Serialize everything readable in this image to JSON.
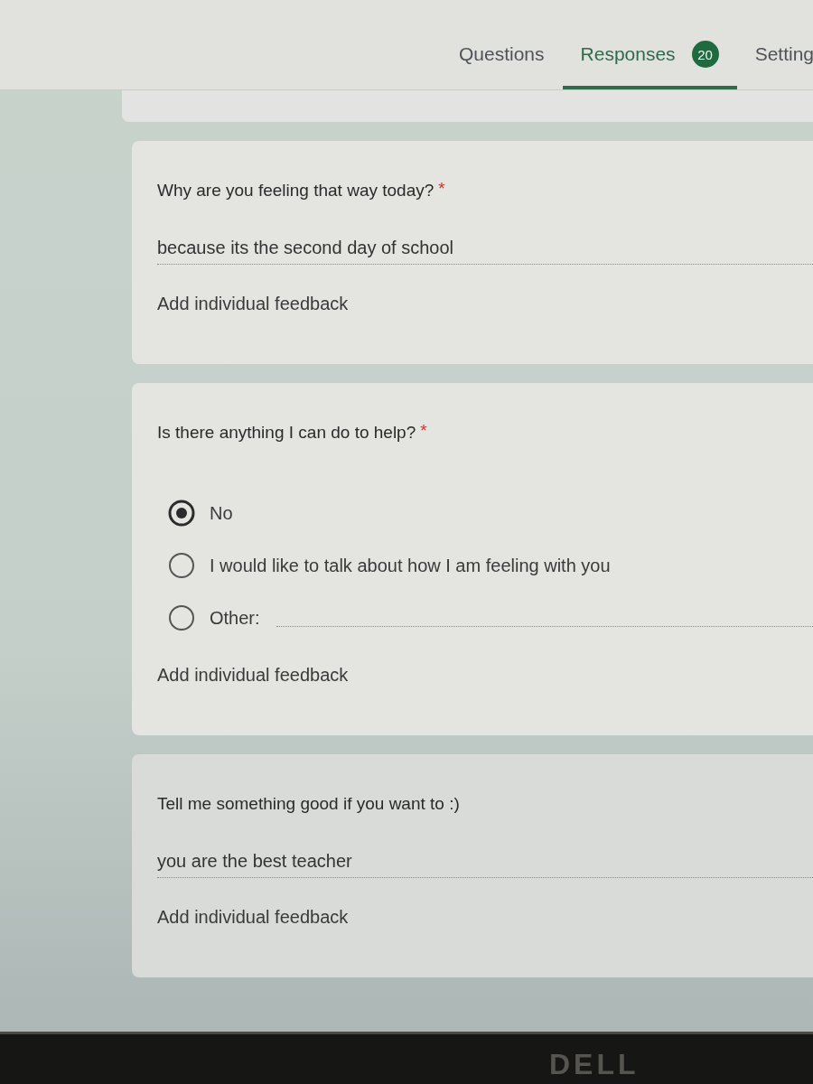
{
  "tabs": [
    {
      "label": "Questions",
      "selected": false
    },
    {
      "label": "Responses",
      "selected": true,
      "badge": "20"
    },
    {
      "label": "Setting",
      "selected": false
    }
  ],
  "questions": [
    {
      "kind": "short_answer",
      "title": "Why are you feeling that way today?",
      "required_mark": "*",
      "answer": "because its the second day of school",
      "feedback_link": "Add individual feedback"
    },
    {
      "kind": "multiple_choice",
      "title": "Is there anything I can do to help?",
      "required_mark": "*",
      "options": [
        {
          "kind": "choice",
          "label": "No",
          "selected": true
        },
        {
          "kind": "choice",
          "label": "I would like to talk about how I am feeling with you",
          "selected": false
        },
        {
          "kind": "other",
          "label": "Other:",
          "selected": false
        }
      ],
      "feedback_link": "Add individual feedback"
    },
    {
      "kind": "short_answer",
      "title": "Tell me something good if you want to :)",
      "answer": "you are the best teacher",
      "feedback_link": "Add individual feedback"
    }
  ],
  "monitor": {
    "brand": "DELL"
  }
}
